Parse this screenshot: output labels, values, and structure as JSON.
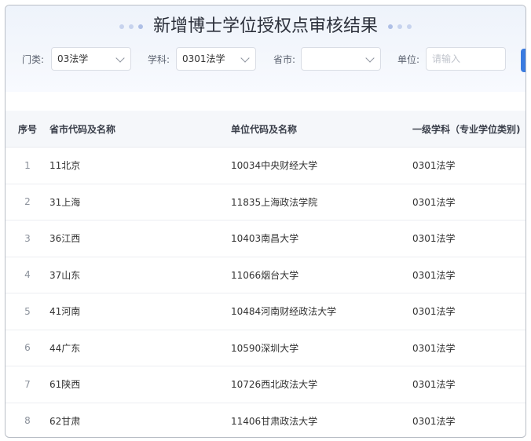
{
  "header": {
    "title": "新增博士学位授权点审核结果"
  },
  "filters": {
    "category_label": "门类:",
    "category_value": "03法学",
    "subject_label": "学科:",
    "subject_value": "0301法学",
    "province_label": "省市:",
    "province_value": "",
    "unit_label": "单位:",
    "unit_placeholder": "请输入"
  },
  "table": {
    "columns": [
      "序号",
      "省市代码及名称",
      "单位代码及名称",
      "一级学科（专业学位类别)"
    ],
    "rows": [
      {
        "idx": "1",
        "province": "11北京",
        "unit": "10034中央财经大学",
        "subject": "0301法学"
      },
      {
        "idx": "2",
        "province": "31上海",
        "unit": "11835上海政法学院",
        "subject": "0301法学"
      },
      {
        "idx": "3",
        "province": "36江西",
        "unit": "10403南昌大学",
        "subject": "0301法学"
      },
      {
        "idx": "4",
        "province": "37山东",
        "unit": "11066烟台大学",
        "subject": "0301法学"
      },
      {
        "idx": "5",
        "province": "41河南",
        "unit": "10484河南财经政法大学",
        "subject": "0301法学"
      },
      {
        "idx": "6",
        "province": "44广东",
        "unit": "10590深圳大学",
        "subject": "0301法学"
      },
      {
        "idx": "7",
        "province": "61陕西",
        "unit": "10726西北政法大学",
        "subject": "0301法学"
      },
      {
        "idx": "8",
        "province": "62甘肃",
        "unit": "11406甘肃政法大学",
        "subject": "0301法学"
      }
    ]
  },
  "colors": {
    "accent": "#3a7be0",
    "header_bg": "#f5f7fa"
  }
}
